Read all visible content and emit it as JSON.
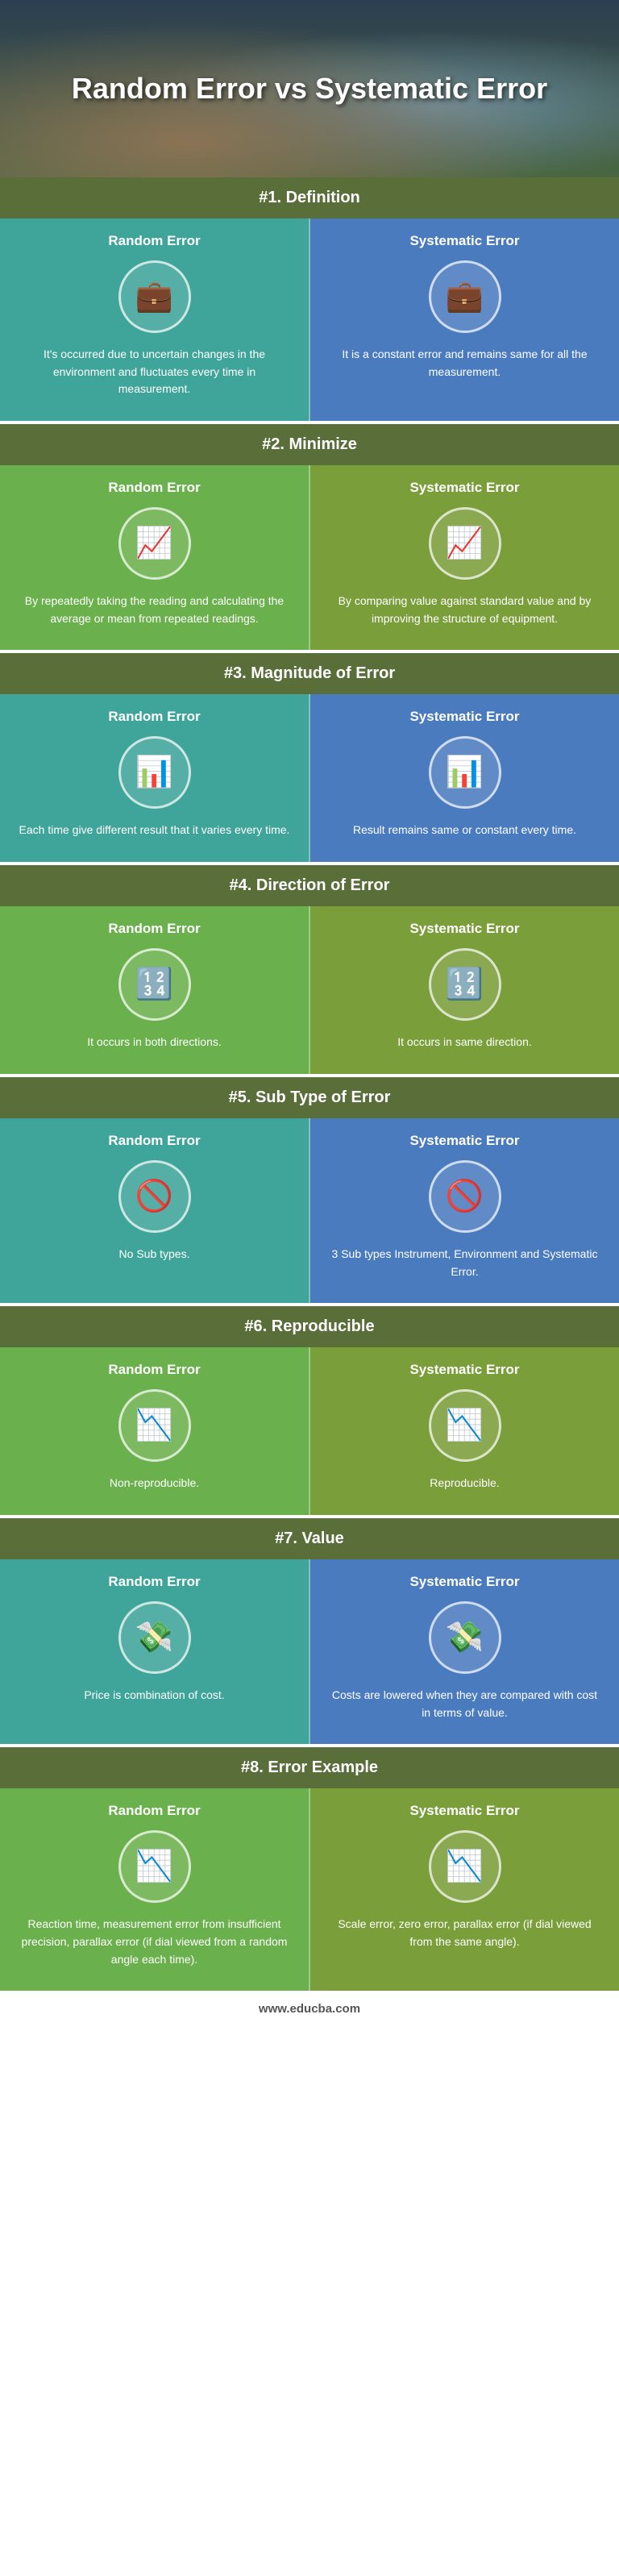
{
  "header": {
    "title": "Random Error vs\nSystematic Error"
  },
  "sections": [
    {
      "id": "s1",
      "heading": "#1. Definition",
      "left_label": "Random Error",
      "left_icon": "💼",
      "left_text": "It's occurred due to uncertain changes in the environment and fluctuates every time in measurement.",
      "right_label": "Systematic Error",
      "right_icon": "💼",
      "right_text": "It is a constant error and remains same for all the measurement.",
      "left_bg": "bg-teal",
      "right_bg": "bg-blue"
    },
    {
      "id": "s2",
      "heading": "#2. Minimize",
      "left_label": "Random Error",
      "left_icon": "📈",
      "left_text": "By repeatedly taking the reading and calculating the average or mean from repeated readings.",
      "right_label": "Systematic Error",
      "right_icon": "📈",
      "right_text": "By comparing value against standard value and by improving the structure of equipment.",
      "left_bg": "bg-green",
      "right_bg": "bg-olive"
    },
    {
      "id": "s3",
      "heading": "#3. Magnitude of Error",
      "left_label": "Random Error",
      "left_icon": "📊",
      "left_text": "Each time give different result that it varies every time.",
      "right_label": "Systematic Error",
      "right_icon": "📊",
      "right_text": "Result remains same or constant every time.",
      "left_bg": "bg-teal",
      "right_bg": "bg-blue"
    },
    {
      "id": "s4",
      "heading": "#4. Direction of Error",
      "left_label": "Random Error",
      "left_icon": "🔢",
      "left_text": "It occurs in both directions.",
      "right_label": "Systematic Error",
      "right_icon": "🔢",
      "right_text": "It occurs in same direction.",
      "left_bg": "bg-green",
      "right_bg": "bg-olive"
    },
    {
      "id": "s5",
      "heading": "#5. Sub Type of Error",
      "left_label": "Random Error",
      "left_icon": "🚫",
      "left_text": "No Sub types.",
      "right_label": "Systematic Error",
      "right_icon": "🚫",
      "right_text": "3 Sub types Instrument, Environment and Systematic Error.",
      "left_bg": "bg-teal",
      "right_bg": "bg-blue"
    },
    {
      "id": "s6",
      "heading": "#6. Reproducible",
      "left_label": "Random Error",
      "left_icon": "📉",
      "left_text": "Non-reproducible.",
      "right_label": "Systematic Error",
      "right_icon": "📉",
      "right_text": "Reproducible.",
      "left_bg": "bg-green",
      "right_bg": "bg-olive"
    },
    {
      "id": "s7",
      "heading": "#7. Value",
      "left_label": "Random Error",
      "left_icon": "💸",
      "left_text": "Price is combination of cost.",
      "right_label": "Systematic Error",
      "right_icon": "💸",
      "right_text": "Costs are lowered when they are compared with cost in terms of value.",
      "left_bg": "bg-teal",
      "right_bg": "bg-blue"
    },
    {
      "id": "s8",
      "heading": "#8. Error Example",
      "left_label": "Random Error",
      "left_icon": "📉",
      "left_text": "Reaction time, measurement error from insufficient precision, parallax error (if dial viewed from a random angle each time).",
      "right_label": "Systematic Error",
      "right_icon": "📉",
      "right_text": "Scale error, zero error, parallax error (if dial viewed from the same angle).",
      "left_bg": "bg-green",
      "right_bg": "bg-olive"
    }
  ],
  "footer": {
    "url": "www.educba.com"
  }
}
